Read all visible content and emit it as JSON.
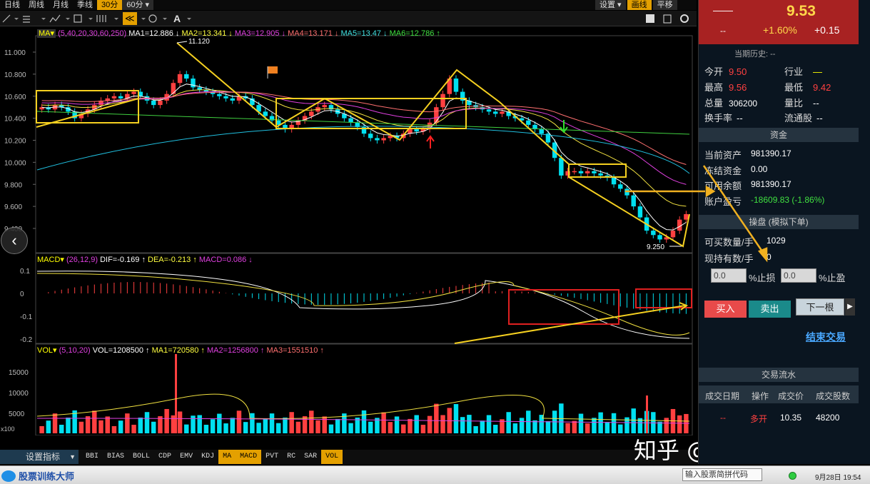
{
  "period_tabs": [
    {
      "label": "日线"
    },
    {
      "label": "周线"
    },
    {
      "label": "月线"
    },
    {
      "label": "季线"
    },
    {
      "label": "30分"
    },
    {
      "label": "60分 ▾"
    }
  ],
  "right_tabs": [
    {
      "label": "设置 ▾"
    },
    {
      "label": "画线"
    },
    {
      "label": "平移"
    }
  ],
  "tools": {
    "highlight": "≪"
  },
  "legends": {
    "ma": {
      "title": "MA▾",
      "params": "(5,40,20,30,60,250)",
      "ma1": "MA1=12.886 ↓",
      "ma2": "MA2=13.341 ↓",
      "ma3": "MA3=12.905 ↓",
      "ma4": "MA4=13.171 ↓",
      "ma5": "MA5=13.47 ↓",
      "ma6": "MA6=12.786 ↑"
    },
    "macd": {
      "title": "MACD▾",
      "params": "(26,12,9)",
      "dif": "DIF=-0.169 ↑",
      "dea": "DEA=-0.213 ↑",
      "macd": "MACD=0.086 ↓"
    },
    "vol": {
      "title": "VOL▾",
      "params": "(5,10,20)",
      "vol": "VOL=1208500 ↑",
      "ma1": "MA1=720580 ↑",
      "ma2": "MA2=1256800 ↑",
      "ma3": "MA3=1551510 ↑"
    }
  },
  "labels": {
    "high": "11.120",
    "low": "9.250",
    "period": "30分钟",
    "vol_unit": "x100"
  },
  "y_axis_price": [
    "11.000",
    "10.800",
    "10.600",
    "10.400",
    "10.200",
    "10.000",
    "9.800",
    "9.600",
    "9.400"
  ],
  "y_axis_macd": [
    "0.1",
    "0",
    "-0.1",
    "-0.2"
  ],
  "y_axis_vol": [
    "15000",
    "10000",
    "5000"
  ],
  "indicators": [
    {
      "label": "BBI"
    },
    {
      "label": "BIAS"
    },
    {
      "label": "BOLL"
    },
    {
      "label": "CDP"
    },
    {
      "label": "EMV"
    },
    {
      "label": "KDJ"
    },
    {
      "label": "MA",
      "active": true
    },
    {
      "label": "MACD",
      "active": true
    },
    {
      "label": "PVT"
    },
    {
      "label": "RC"
    },
    {
      "label": "SAR"
    },
    {
      "label": "VOL",
      "active": true
    }
  ],
  "indicator_settings": "设置指标",
  "status": {
    "brand": "股票训练大师",
    "code_placeholder": "输入股票简拼代码",
    "clock": "9月28日 19:54"
  },
  "watermark": "知乎 @阿甘的股事",
  "quote": {
    "name": "——",
    "price": "9.53",
    "dash": "--",
    "pct": "+1.60%",
    "chg": "+0.15"
  },
  "history": "当期历史: --",
  "stats": {
    "open": {
      "k": "今开",
      "v": "9.50"
    },
    "industry": {
      "k": "行业",
      "v": "—"
    },
    "high": {
      "k": "最高",
      "v": "9.56"
    },
    "low": {
      "k": "最低",
      "v": "9.42"
    },
    "volume": {
      "k": "总量",
      "v": "306200"
    },
    "ratio": {
      "k": "量比",
      "v": "--"
    },
    "turnover": {
      "k": "换手率",
      "v": "--"
    },
    "float": {
      "k": "流通股",
      "v": "--"
    }
  },
  "funds": {
    "header": "资金",
    "assets": {
      "k": "当前资产",
      "v": "981390.17"
    },
    "frozen": {
      "k": "冻结资金",
      "v": "0.00"
    },
    "available": {
      "k": "可用余额",
      "v": "981390.17"
    },
    "pnl": {
      "k": "账户盈亏",
      "v": "-18609.83  (-1.86%)"
    }
  },
  "trade": {
    "header": "操盘 (模拟下单)",
    "buyable": {
      "k": "可买数量/手",
      "v": "1029"
    },
    "holding": {
      "k": "现持有数/手",
      "v": "0"
    },
    "stop_loss_value": "0.0",
    "stop_loss_label": "%止损",
    "take_profit_value": "0.0",
    "take_profit_label": "%止盈",
    "buy": "买入",
    "sell": "卖出",
    "next": "下一根",
    "end": "结束交易"
  },
  "flow": {
    "header": "交易流水",
    "columns": [
      "成交日期",
      "操作",
      "成交价",
      "成交股数"
    ],
    "rows": [
      {
        "date": "--",
        "op": "多开",
        "price": "10.35",
        "shares": "48200"
      }
    ]
  },
  "colors": {
    "up": "#ff4040",
    "down": "#00e0f0",
    "ma_yellow": "#f0e040",
    "ma_pink": "#e040e0",
    "ma_cyan": "#20c0e0",
    "ma_green": "#40d040",
    "annotation": "#f5d020",
    "box_red": "#e02020",
    "arrow_orange": "#f0a020"
  }
}
